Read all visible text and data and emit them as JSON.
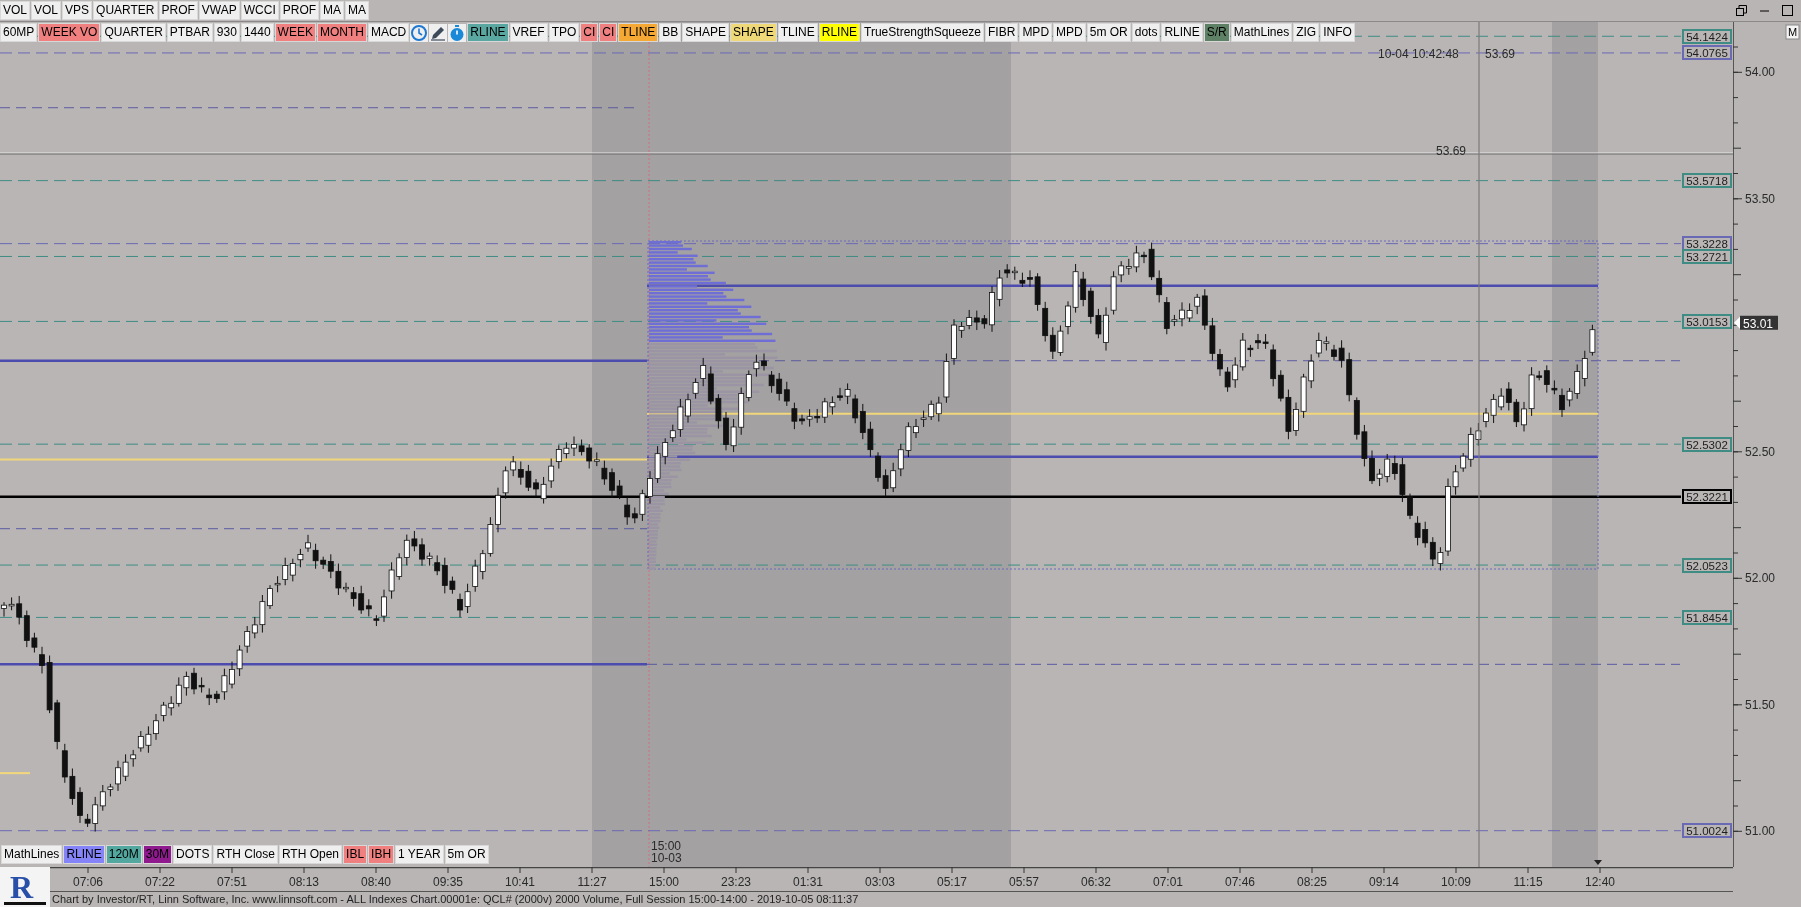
{
  "toolbar_top": [
    {
      "label": "VOL",
      "color": "#efefef"
    },
    {
      "label": "VOL",
      "color": "#efefef"
    },
    {
      "label": "VPS",
      "color": "#efefef"
    },
    {
      "label": "QUARTER",
      "color": "#efefef"
    },
    {
      "label": "PROF",
      "color": "#efefef"
    },
    {
      "label": "VWAP",
      "color": "#efefef"
    },
    {
      "label": "WCCI",
      "color": "#efefef"
    },
    {
      "label": "PROF",
      "color": "#efefef"
    },
    {
      "label": "MA",
      "color": "#efefef"
    },
    {
      "label": "MA",
      "color": "#efefef"
    }
  ],
  "toolbar_main_left": [
    {
      "label": "60MP",
      "color": "#efefef"
    },
    {
      "label": "WEEK VO",
      "color": "#f08080"
    },
    {
      "label": "QUARTER",
      "color": "#efefef"
    },
    {
      "label": "PTBAR",
      "color": "#efefef"
    },
    {
      "label": "930",
      "color": "#efefef"
    },
    {
      "label": "1440",
      "color": "#efefef"
    },
    {
      "label": "WEEK",
      "color": "#f08080"
    },
    {
      "label": "MONTH",
      "color": "#f08080"
    },
    {
      "label": "MACD",
      "color": "#efefef"
    }
  ],
  "toolbar_main_right": [
    {
      "label": "RLINE",
      "color": "#5aa6a0"
    },
    {
      "label": "VREF",
      "color": "#efefef"
    },
    {
      "label": "TPO",
      "color": "#efefef"
    },
    {
      "label": "CI",
      "color": "#f08080"
    },
    {
      "label": "CI",
      "color": "#f08080"
    },
    {
      "label": "TLINE",
      "color": "#f5a833"
    },
    {
      "label": "BB",
      "color": "#efefef"
    },
    {
      "label": "SHAPE",
      "color": "#efefef"
    },
    {
      "label": "SHAPE",
      "color": "#efd877"
    },
    {
      "label": "TLINE",
      "color": "#efefef"
    },
    {
      "label": "RLINE",
      "color": "#ffff00"
    },
    {
      "label": "TrueStrengthSqueeze",
      "color": "#efefef"
    },
    {
      "label": "FIBR",
      "color": "#efefef"
    },
    {
      "label": "MPD",
      "color": "#efefef"
    },
    {
      "label": "MPD",
      "color": "#efefef"
    },
    {
      "label": "5m OR",
      "color": "#efefef"
    },
    {
      "label": "dots",
      "color": "#efefef"
    },
    {
      "label": "RLINE",
      "color": "#efefef"
    },
    {
      "label": "S/R",
      "color": "#5e8064"
    },
    {
      "label": "MathLines",
      "color": "#efefef"
    },
    {
      "label": "ZIG",
      "color": "#efefef"
    },
    {
      "label": "INFO",
      "color": "#efefef"
    }
  ],
  "toolbar_bottom": [
    {
      "label": "MathLines",
      "color": "#efefef"
    },
    {
      "label": "RLINE",
      "color": "#8484f8"
    },
    {
      "label": "120M",
      "color": "#52a89e"
    },
    {
      "label": "30M",
      "color": "#8e1a8e"
    },
    {
      "label": "DOTS",
      "color": "#efefef"
    },
    {
      "label": "RTH Close",
      "color": "#efefef"
    },
    {
      "label": "RTH Open",
      "color": "#efefef"
    },
    {
      "label": "IBL",
      "color": "#f08080"
    },
    {
      "label": "IBH",
      "color": "#f08080"
    },
    {
      "label": "1 YEAR",
      "color": "#efefef"
    },
    {
      "label": "5m OR",
      "color": "#efefef"
    }
  ],
  "chart": {
    "crosshair_time": "10-04 10:42:48",
    "crosshair_price": "53.69",
    "crosshair_price_marker": "53.69",
    "session_time": "15:00",
    "session_date": "10-03",
    "current_price": "53.01",
    "axis_mode": "M",
    "levels": [
      {
        "label": "54.1424",
        "color": "#3f8c84",
        "kind": "dashed"
      },
      {
        "label": "54.0765",
        "color": "#6a6ab4",
        "kind": "dashed"
      },
      {
        "label": "53.5718",
        "color": "#3f8c84",
        "kind": "dashed"
      },
      {
        "label": "53.3228",
        "color": "#6a6ab4",
        "kind": "dashed"
      },
      {
        "label": "53.2721",
        "color": "#3f8c84",
        "kind": "dashed"
      },
      {
        "label": "53.0153",
        "color": "#3f8c84",
        "kind": "dashed"
      },
      {
        "label": "52.5302",
        "color": "#3f8c84",
        "kind": "dashed"
      },
      {
        "label": "52.3221",
        "color": "#000000",
        "kind": "solid"
      },
      {
        "label": "52.0523",
        "color": "#3f8c84",
        "kind": "dashed"
      },
      {
        "label": "51.8454",
        "color": "#3f8c84",
        "kind": "dashed"
      },
      {
        "label": "51.0024",
        "color": "#6a6ab4",
        "kind": "dashed"
      }
    ],
    "price_ticks": [
      "54.00",
      "53.50",
      "52.50",
      "52.00",
      "51.50",
      "51.00"
    ],
    "time_ticks": [
      "07:06",
      "07:22",
      "07:51",
      "08:13",
      "08:40",
      "09:35",
      "10:41",
      "11:27",
      "15:00",
      "23:23",
      "01:31",
      "03:03",
      "05:17",
      "05:57",
      "06:32",
      "07:01",
      "07:46",
      "08:25",
      "09:14",
      "10:09",
      "11:15",
      "12:40"
    ]
  },
  "logo_letter": "R",
  "footer": "Chart by Investor/RT, Linn Software, Inc. www.linnsoft.com - ALL Indexes Chart.00001e: QCL# (2000v) 2000 Volume, Full Session 15:00-14:00 - 2019-10-05 08:11:37"
}
